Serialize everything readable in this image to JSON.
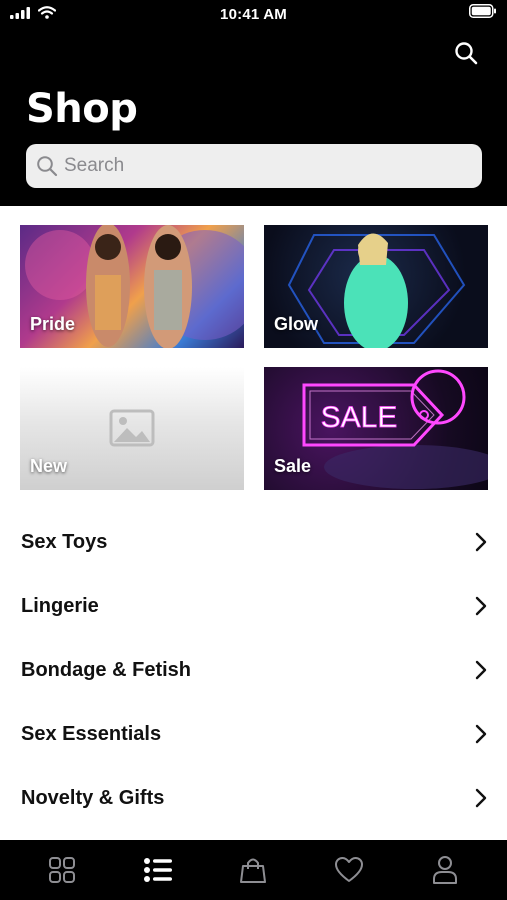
{
  "status_bar": {
    "time": "10:41 AM"
  },
  "header": {
    "title": "Shop",
    "search_placeholder": "Search"
  },
  "tiles": [
    {
      "label": "Pride"
    },
    {
      "label": "Glow"
    },
    {
      "label": "New"
    },
    {
      "label": "Sale",
      "sign_text": "SALE"
    }
  ],
  "categories": [
    {
      "label": "Sex Toys"
    },
    {
      "label": "Lingerie"
    },
    {
      "label": "Bondage & Fetish"
    },
    {
      "label": "Sex Essentials"
    },
    {
      "label": "Novelty & Gifts"
    }
  ],
  "tab_bar": {
    "tabs": [
      {
        "icon": "grid-icon",
        "active": false
      },
      {
        "icon": "list-icon",
        "active": true
      },
      {
        "icon": "bag-icon",
        "active": false
      },
      {
        "icon": "heart-icon",
        "active": false
      },
      {
        "icon": "person-icon",
        "active": false
      }
    ]
  },
  "colors": {
    "header_bg": "#000000",
    "search_bg": "#eeeeee",
    "sale_neon": "#e03cff",
    "glow_neon": "#2ee6c9"
  }
}
